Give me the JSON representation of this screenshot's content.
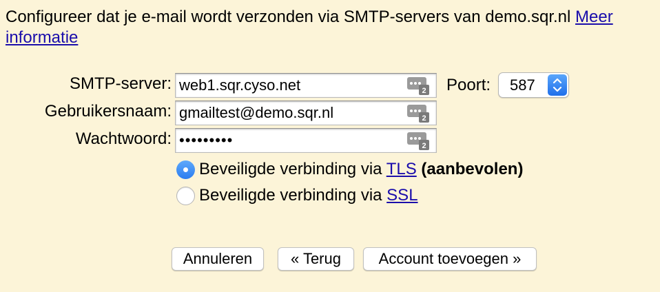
{
  "intro": {
    "text": "Configureer dat je e-mail wordt verzonden via SMTP-servers van demo.sqr.nl ",
    "link": "Meer informatie"
  },
  "smtp": {
    "label": "SMTP-server:",
    "value": "web1.sqr.cyso.net"
  },
  "port": {
    "label": "Poort:",
    "selected": "587"
  },
  "username": {
    "label": "Gebruikersnaam:",
    "value": "gmailtest@demo.sqr.nl"
  },
  "password": {
    "label": "Wachtwoord:",
    "value": "•••••••••"
  },
  "security": {
    "tls": {
      "prefix": "Beveiligde verbinding via ",
      "link": "TLS",
      "suffix": "(aanbevolen)",
      "checked": true
    },
    "ssl": {
      "prefix": "Beveiligde verbinding via ",
      "link": "SSL",
      "checked": false
    }
  },
  "buttons": {
    "cancel": "Annuleren",
    "back": "« Terug",
    "add": "Account toevoegen »"
  },
  "colors": {
    "background": "#fcf4d8",
    "link": "#1a0dab",
    "accent": "#2b7df0"
  },
  "icons": {
    "field_icon": "password-manager-key-icon",
    "select_icon": "updown-arrows-icon"
  }
}
